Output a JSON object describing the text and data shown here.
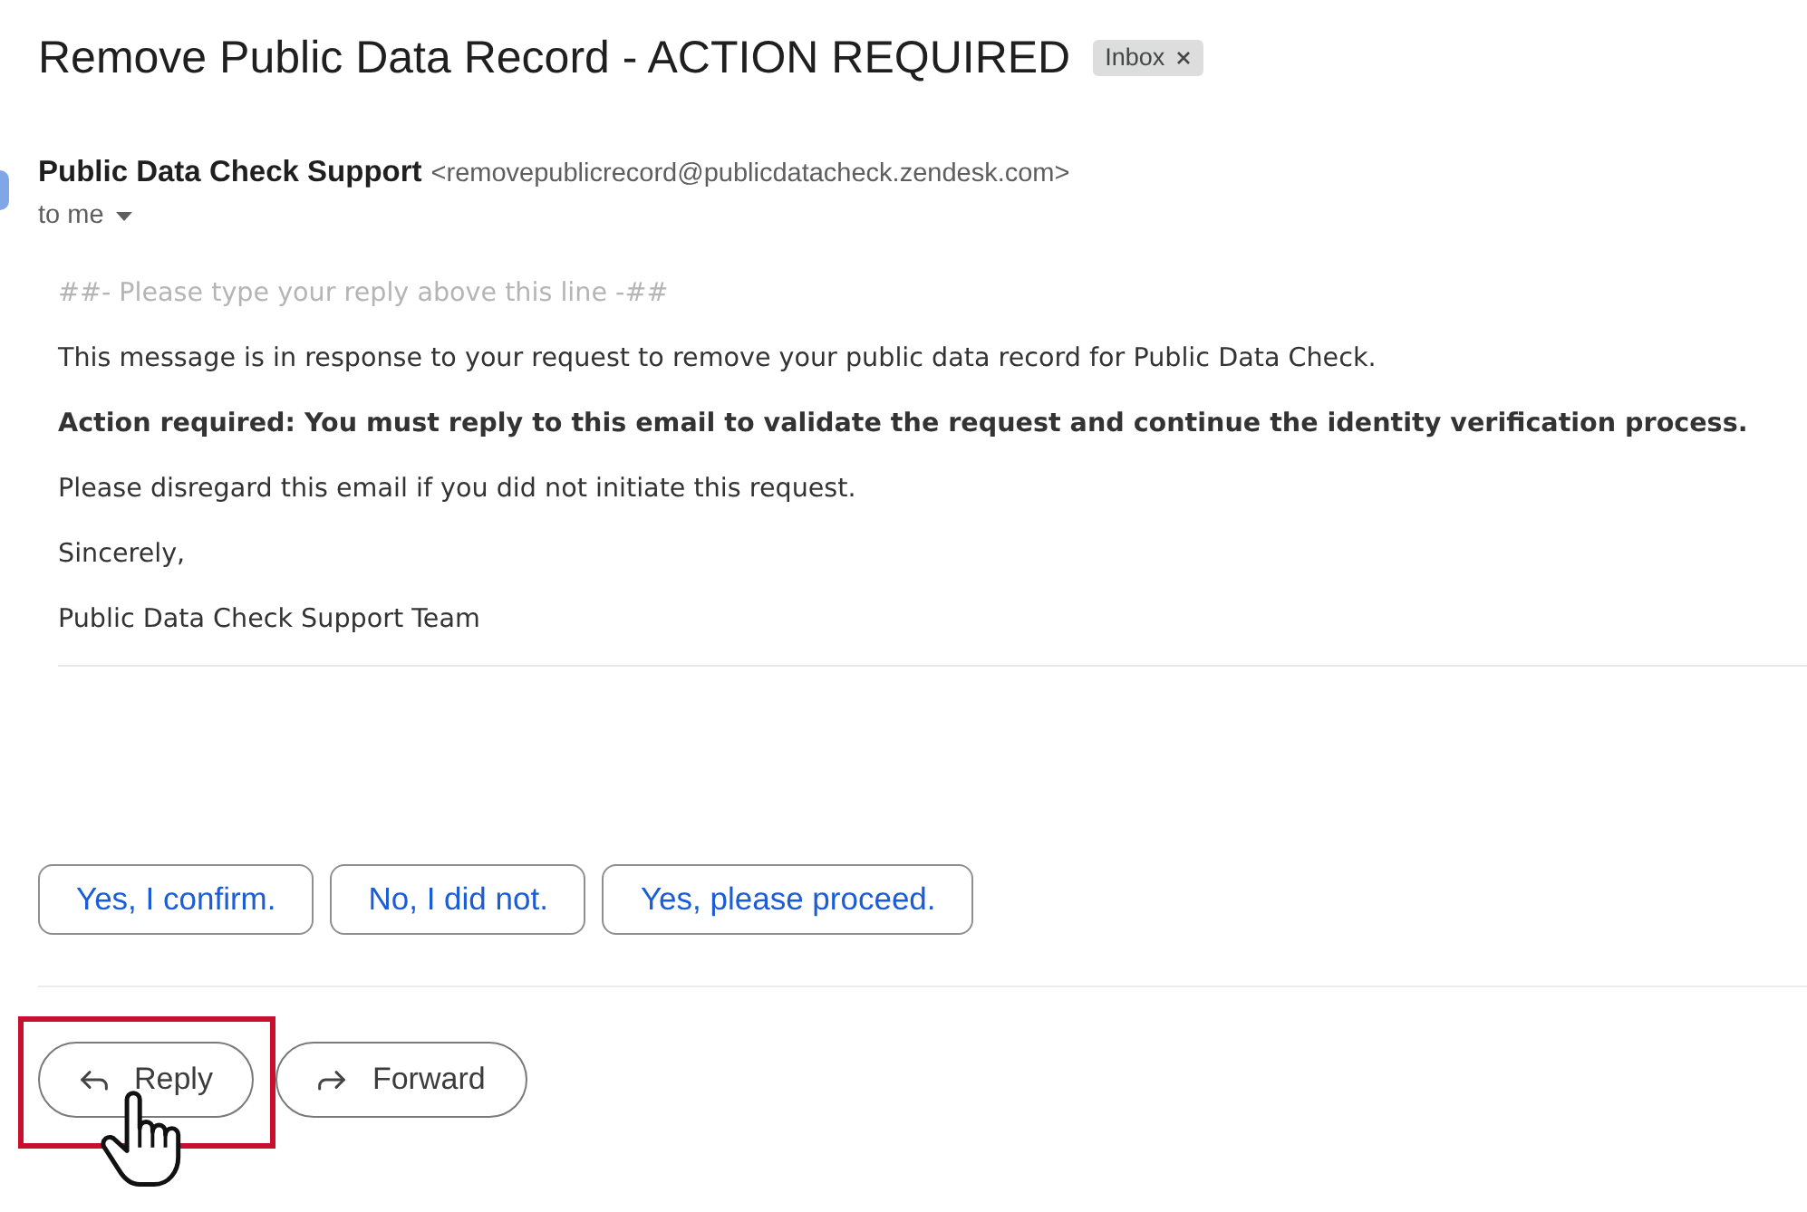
{
  "email": {
    "subject": "Remove Public Data Record - ACTION REQUIRED",
    "labels": [
      {
        "text": "Inbox",
        "removable": true
      }
    ]
  },
  "sender": {
    "name": "Public Data Check Support",
    "address": "<removepublicrecord@publicdatacheck.zendesk.com>",
    "recipient": "to me"
  },
  "body": {
    "paragraphs": [
      {
        "kind": "quote",
        "text": "##- Please type your reply above this line -##"
      },
      {
        "kind": "plain",
        "text": "This message is in response to your request to remove your public data record for Public Data Check."
      },
      {
        "kind": "bold",
        "text": "Action required: You must reply to this email to validate the request and continue the identity verification process."
      },
      {
        "kind": "plain",
        "text": "Please disregard this email if you did not initiate this request."
      },
      {
        "kind": "plain",
        "text": "Sincerely,"
      },
      {
        "kind": "plain",
        "text": "Public Data Check Support Team"
      }
    ]
  },
  "quick_replies": [
    "Yes, I confirm.",
    "No, I did not.",
    "Yes, please proceed."
  ],
  "actions": [
    {
      "kind": "reply",
      "label": "Reply",
      "highlighted": true
    },
    {
      "kind": "forward",
      "label": "Forward",
      "highlighted": false
    }
  ]
}
